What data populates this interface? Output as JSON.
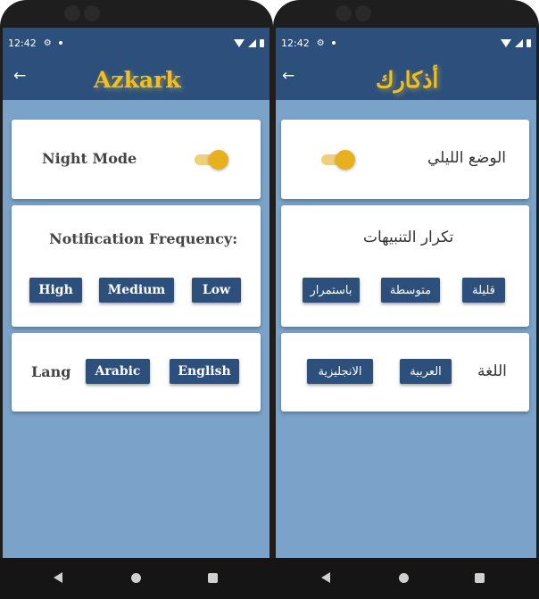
{
  "status_bar": {
    "time": "12:42",
    "settings_icon": "gear-icon"
  },
  "english_screen": {
    "title": "Azkark",
    "night_mode_label": "Night Mode",
    "night_mode_on": true,
    "notification_label": "Notification Frequency:",
    "frequency_buttons": [
      "High",
      "Medium",
      "Low"
    ],
    "lang_label": "Lang",
    "lang_buttons": [
      "Arabic",
      "English"
    ]
  },
  "arabic_screen": {
    "title": "أذكارك",
    "night_mode_label": "الوضع الليلي",
    "night_mode_on": true,
    "notification_label": "تكرار التنبيهات",
    "frequency_buttons": [
      "باستمرار",
      "متوسطة",
      "قليلة"
    ],
    "lang_label": "اللغة",
    "lang_buttons": [
      "الانجليزية",
      "العربية"
    ]
  },
  "colors": {
    "primary": "#2c4f7b",
    "background": "#7ba3c9",
    "accent": "#e8b01d",
    "title": "#f5be1c"
  },
  "icons": {
    "back": "arrow-left-icon",
    "nav_back": "triangle-back-icon",
    "nav_home": "circle-home-icon",
    "nav_recent": "square-recent-icon"
  }
}
